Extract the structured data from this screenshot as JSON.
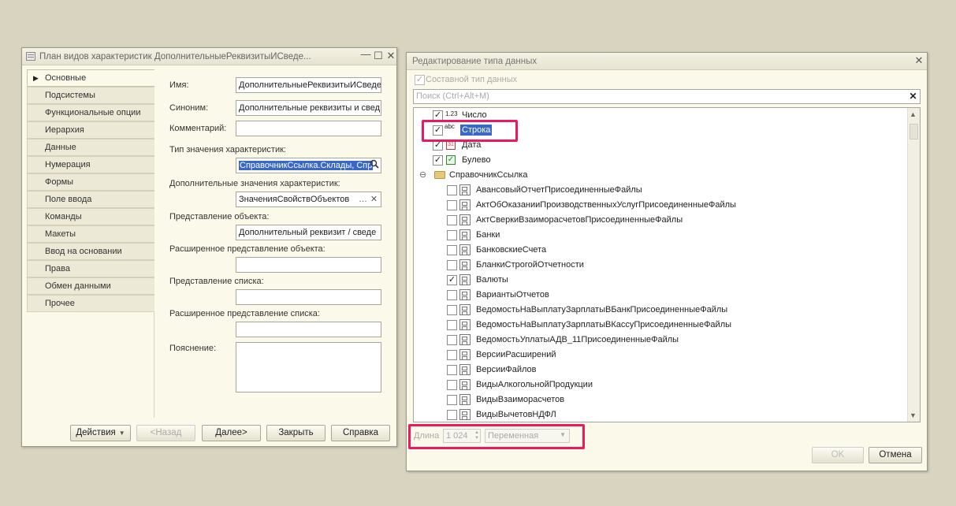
{
  "left_window": {
    "title": "План видов характеристик ДополнительныеРеквизитыИСведе...",
    "controls": {
      "minimize": "—",
      "maximize": "☐",
      "close": "✕"
    },
    "tabs": [
      {
        "label": "Основные"
      },
      {
        "label": "Подсистемы"
      },
      {
        "label": "Функциональные опции"
      },
      {
        "label": "Иерархия"
      },
      {
        "label": "Данные"
      },
      {
        "label": "Нумерация"
      },
      {
        "label": "Формы"
      },
      {
        "label": "Поле ввода"
      },
      {
        "label": "Команды"
      },
      {
        "label": "Макеты"
      },
      {
        "label": "Ввод на основании"
      },
      {
        "label": "Права"
      },
      {
        "label": "Обмен данными"
      },
      {
        "label": "Прочее"
      }
    ],
    "fields": {
      "name_label": "Имя:",
      "name_value": "ДополнительныеРеквизитыИСведе",
      "synonym_label": "Синоним:",
      "synonym_value": "Дополнительные реквизиты и свед",
      "comment_label": "Комментарий:",
      "comment_value": "",
      "value_type_label": "Тип значения характеристик:",
      "value_type_value": "СправочникСсылка.Склады, Спр",
      "extra_values_label": "Дополнительные значения характеристик:",
      "extra_values_value": "ЗначенияСвойствОбъектов",
      "object_repr_label": "Представление объекта:",
      "object_repr_value": "Дополнительный реквизит / сведе",
      "ext_object_repr_label": "Расширенное представление объекта:",
      "ext_object_repr_value": "",
      "list_repr_label": "Представление списка:",
      "list_repr_value": "",
      "ext_list_repr_label": "Расширенное представление списка:",
      "ext_list_repr_value": "",
      "explanation_label": "Пояснение:",
      "explanation_value": ""
    },
    "buttons": {
      "actions": "Действия",
      "back": "<Назад",
      "next": "Далее>",
      "close": "Закрыть",
      "help": "Справка"
    }
  },
  "right_window": {
    "title": "Редактирование типа данных",
    "close": "✕",
    "composite_label": "Составной тип данных",
    "composite_checked": true,
    "search_placeholder": "Поиск (Ctrl+Alt+M)",
    "search_clear": "✕",
    "primitives": [
      {
        "label": "Число",
        "checked": true,
        "icon": "number-icon",
        "icon_text": "1.23"
      },
      {
        "label": "Строка",
        "checked": true,
        "icon": "string-icon",
        "icon_text": "abc"
      },
      {
        "label": "Дата",
        "checked": true,
        "icon": "date-icon",
        "icon_text": "31"
      },
      {
        "label": "Булево",
        "checked": true,
        "icon": "boolean-icon",
        "icon_text": "✓"
      }
    ],
    "group_label": "СправочникСсылка",
    "group_toggle": "⊖",
    "refs": [
      {
        "label": "АвансовыйОтчетПрисоединенныеФайлы",
        "checked": false
      },
      {
        "label": "АктОбОказанииПроизводственныхУслугПрисоединенныеФайлы",
        "checked": false
      },
      {
        "label": "АктСверкиВзаиморасчетовПрисоединенныеФайлы",
        "checked": false
      },
      {
        "label": "Банки",
        "checked": false
      },
      {
        "label": "БанковскиеСчета",
        "checked": false
      },
      {
        "label": "БланкиСтрогойОтчетности",
        "checked": false
      },
      {
        "label": "Валюты",
        "checked": true
      },
      {
        "label": "ВариантыОтчетов",
        "checked": false
      },
      {
        "label": "ВедомостьНаВыплатуЗарплатыВБанкПрисоединенныеФайлы",
        "checked": false
      },
      {
        "label": "ВедомостьНаВыплатуЗарплатыВКассуПрисоединенныеФайлы",
        "checked": false
      },
      {
        "label": "ВедомостьУплатыАДВ_11ПрисоединенныеФайлы",
        "checked": false
      },
      {
        "label": "ВерсииРасширений",
        "checked": false
      },
      {
        "label": "ВерсииФайлов",
        "checked": false
      },
      {
        "label": "ВидыАлкогольнойПродукции",
        "checked": false
      },
      {
        "label": "ВидыВзаиморасчетов",
        "checked": false
      },
      {
        "label": "ВидыВычетовНДФЛ",
        "checked": false
      }
    ],
    "length_label": "Длина",
    "length_value": "1 024",
    "length_kind": "Переменная",
    "ok": "OK",
    "cancel": "Отмена"
  },
  "colors": {
    "desktop": "#d9d4bf",
    "window": "#fbf9ea",
    "selection": "#3a68c8",
    "highlight_box": "#ec1a5d"
  }
}
